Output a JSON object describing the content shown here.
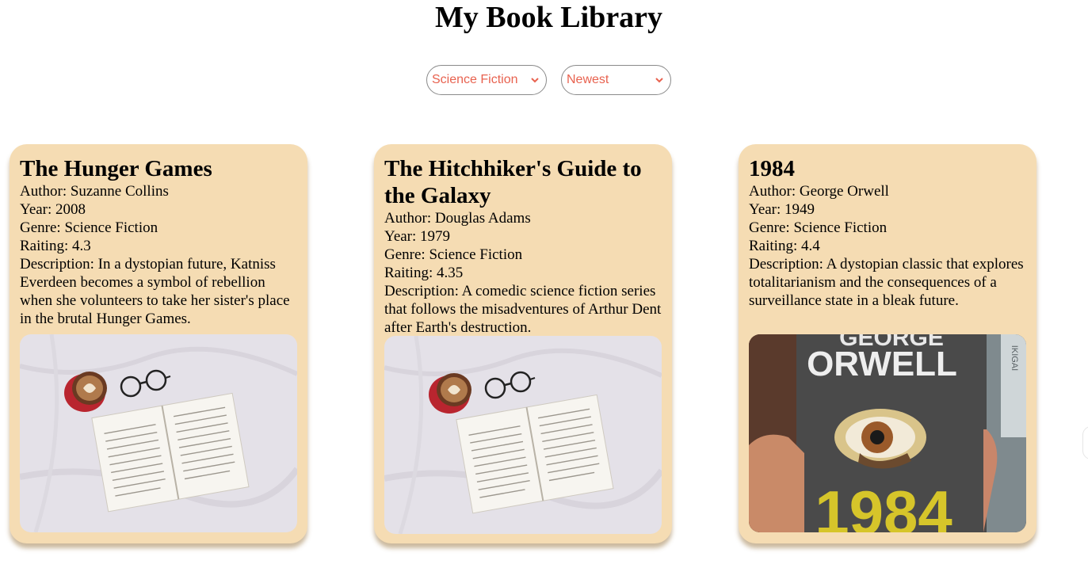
{
  "header": {
    "title": "My Book Library"
  },
  "filters": {
    "genre": {
      "selected": "Science Fiction"
    },
    "sort": {
      "selected": "Newest"
    }
  },
  "colors": {
    "card_background": "#f5dcb3",
    "select_text": "#e8624f"
  },
  "books": [
    {
      "title": "The Hunger Games",
      "author": "Author: Suzanne Collins",
      "year": "Year: 2008",
      "genre": "Genre: Science Fiction",
      "rating": "Raiting: 4.3",
      "description": "Description: In a dystopian future, Katniss Everdeen becomes a symbol of rebellion when she volunteers to take her sister's place in the brutal Hunger Games.",
      "image": "open-book-coffee-glasses-photo"
    },
    {
      "title": "The Hitchhiker's Guide to the Galaxy",
      "author": "Author: Douglas Adams",
      "year": "Year: 1979",
      "genre": "Genre: Science Fiction",
      "rating": "Raiting: 4.35",
      "description": "Description: A comedic science fiction series that follows the misadventures of Arthur Dent after Earth's destruction.",
      "image": "open-book-coffee-glasses-photo"
    },
    {
      "title": "1984",
      "author": "Author: George Orwell",
      "year": "Year: 1949",
      "genre": "Genre: Science Fiction",
      "rating": "Raiting: 4.4",
      "description": "Description: A dystopian classic that explores totalitarianism and the consequences of a surveillance state in a bleak future.",
      "image": "1984-book-cover-photo",
      "cover_text": {
        "author_top": "GEORGE",
        "author": "ORWELL",
        "title": "1984",
        "spine": "IKIGAI"
      }
    }
  ]
}
